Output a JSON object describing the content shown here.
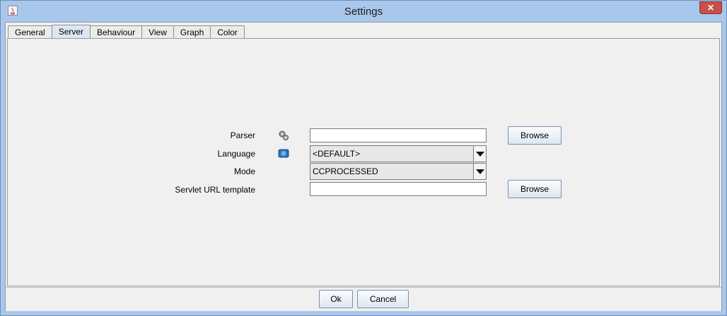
{
  "window": {
    "title": "Settings",
    "close_label": "✕"
  },
  "tabs": [
    {
      "label": "General"
    },
    {
      "label": "Server"
    },
    {
      "label": "Behaviour"
    },
    {
      "label": "View"
    },
    {
      "label": "Graph"
    },
    {
      "label": "Color"
    }
  ],
  "active_tab": "Server",
  "server": {
    "parser_label": "Parser",
    "parser_value": "",
    "parser_browse": "Browse",
    "language_label": "Language",
    "language_value": "<DEFAULT>",
    "mode_label": "Mode",
    "mode_value": "CCPROCESSED",
    "servlet_label": "Servlet URL template",
    "servlet_value": "",
    "servlet_browse": "Browse"
  },
  "footer": {
    "ok_label": "Ok",
    "cancel_label": "Cancel"
  }
}
